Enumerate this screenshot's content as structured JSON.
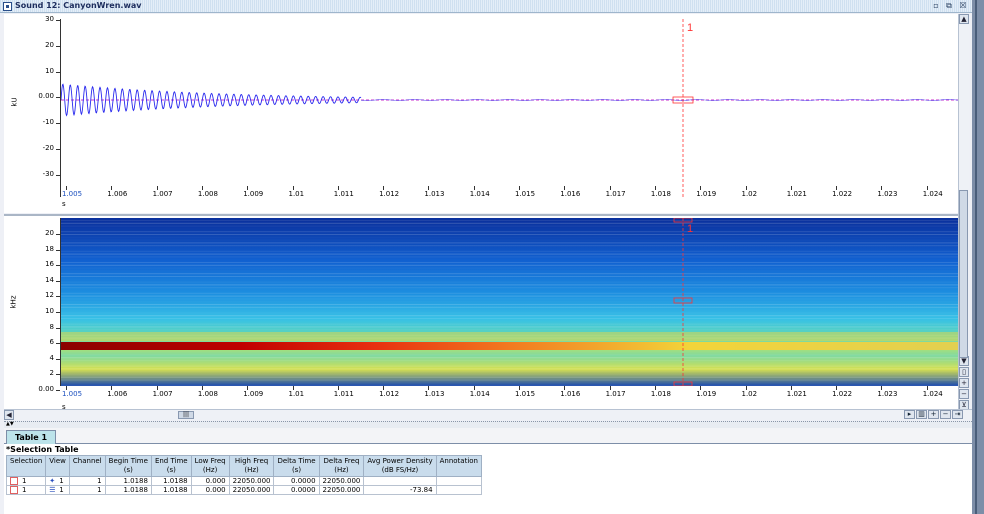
{
  "window": {
    "title": "Sound 12: CanyonWren.wav",
    "buttons": {
      "minimize": "▫",
      "restore": "⧉",
      "close": "☒"
    }
  },
  "waveform": {
    "y_unit": "kU",
    "x_unit": "s",
    "y_ticks": [
      "30",
      "20",
      "10",
      "0.00",
      "-10",
      "-20",
      "-30"
    ],
    "x_ticks": [
      "1.005",
      "1.006",
      "1.007",
      "1.008",
      "1.009",
      "1.01",
      "1.011",
      "1.012",
      "1.013",
      "1.014",
      "1.015",
      "1.016",
      "1.017",
      "1.018",
      "1.019",
      "1.02",
      "1.021",
      "1.022",
      "1.023",
      "1.024"
    ],
    "selection_marker": "1",
    "colors": {
      "wave": "#2a2aee",
      "marker": "#ff3333",
      "axis_line": "#cc33cc"
    }
  },
  "spectrogram": {
    "y_unit": "kHz",
    "x_unit": "s",
    "y_ticks": [
      "20",
      "18",
      "16",
      "14",
      "12",
      "10",
      "8",
      "6",
      "4",
      "2",
      "0.00"
    ],
    "x_ticks": [
      "1.005",
      "1.006",
      "1.007",
      "1.008",
      "1.009",
      "1.01",
      "1.011",
      "1.012",
      "1.013",
      "1.014",
      "1.015",
      "1.016",
      "1.017",
      "1.018",
      "1.019",
      "1.02",
      "1.021",
      "1.022",
      "1.023",
      "1.024"
    ],
    "selection_marker": "1",
    "colors": {
      "low": "#0b3aa8",
      "mid": "#3ec6e8",
      "high": "#f2d43a",
      "peak": "#8a0000"
    }
  },
  "zoom_controls": [
    "▸",
    "▥",
    "+",
    "−",
    "⇥"
  ],
  "tabs": [
    {
      "label": "Table 1"
    }
  ],
  "selection_table": {
    "title": "*Selection Table",
    "columns": [
      {
        "name": "Selection",
        "unit": ""
      },
      {
        "name": "View",
        "unit": ""
      },
      {
        "name": "Channel",
        "unit": ""
      },
      {
        "name": "Begin Time",
        "unit": "(s)"
      },
      {
        "name": "End Time",
        "unit": "(s)"
      },
      {
        "name": "Low Freq",
        "unit": "(Hz)"
      },
      {
        "name": "High Freq",
        "unit": "(Hz)"
      },
      {
        "name": "Delta Time",
        "unit": "(s)"
      },
      {
        "name": "Delta Freq",
        "unit": "(Hz)"
      },
      {
        "name": "Avg Power Density",
        "unit": "(dB FS/Hz)"
      },
      {
        "name": "Annotation",
        "unit": ""
      }
    ],
    "rows": [
      {
        "selection": "1",
        "view": "1",
        "view_icon": "waveform-icon",
        "channel": "1",
        "begin": "1.0188",
        "end": "1.0188",
        "low": "0.000",
        "high": "22050.000",
        "dtime": "0.0000",
        "dfreq": "22050.000",
        "power": "",
        "annotation": ""
      },
      {
        "selection": "1",
        "view": "1",
        "view_icon": "spectrogram-icon",
        "channel": "1",
        "begin": "1.0188",
        "end": "1.0188",
        "low": "0.000",
        "high": "22050.000",
        "dtime": "0.0000",
        "dfreq": "22050.000",
        "power": "-73.84",
        "annotation": ""
      }
    ]
  }
}
